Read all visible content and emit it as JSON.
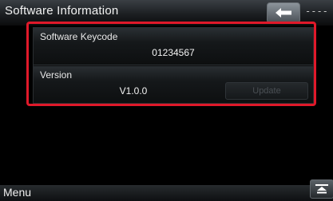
{
  "header": {
    "title": "Software Information",
    "back_icon": "back-arrow-icon",
    "indicator": "----"
  },
  "software_keycode": {
    "label": "Software Keycode",
    "value": "01234567"
  },
  "version": {
    "label": "Version",
    "value": "V1.0.0",
    "update_label": "Update",
    "update_enabled": false
  },
  "side_icon": "screen-toggle-icon",
  "footer": {
    "menu_label": "Menu"
  },
  "colors": {
    "highlight": "#e0192a",
    "background": "#000000"
  }
}
